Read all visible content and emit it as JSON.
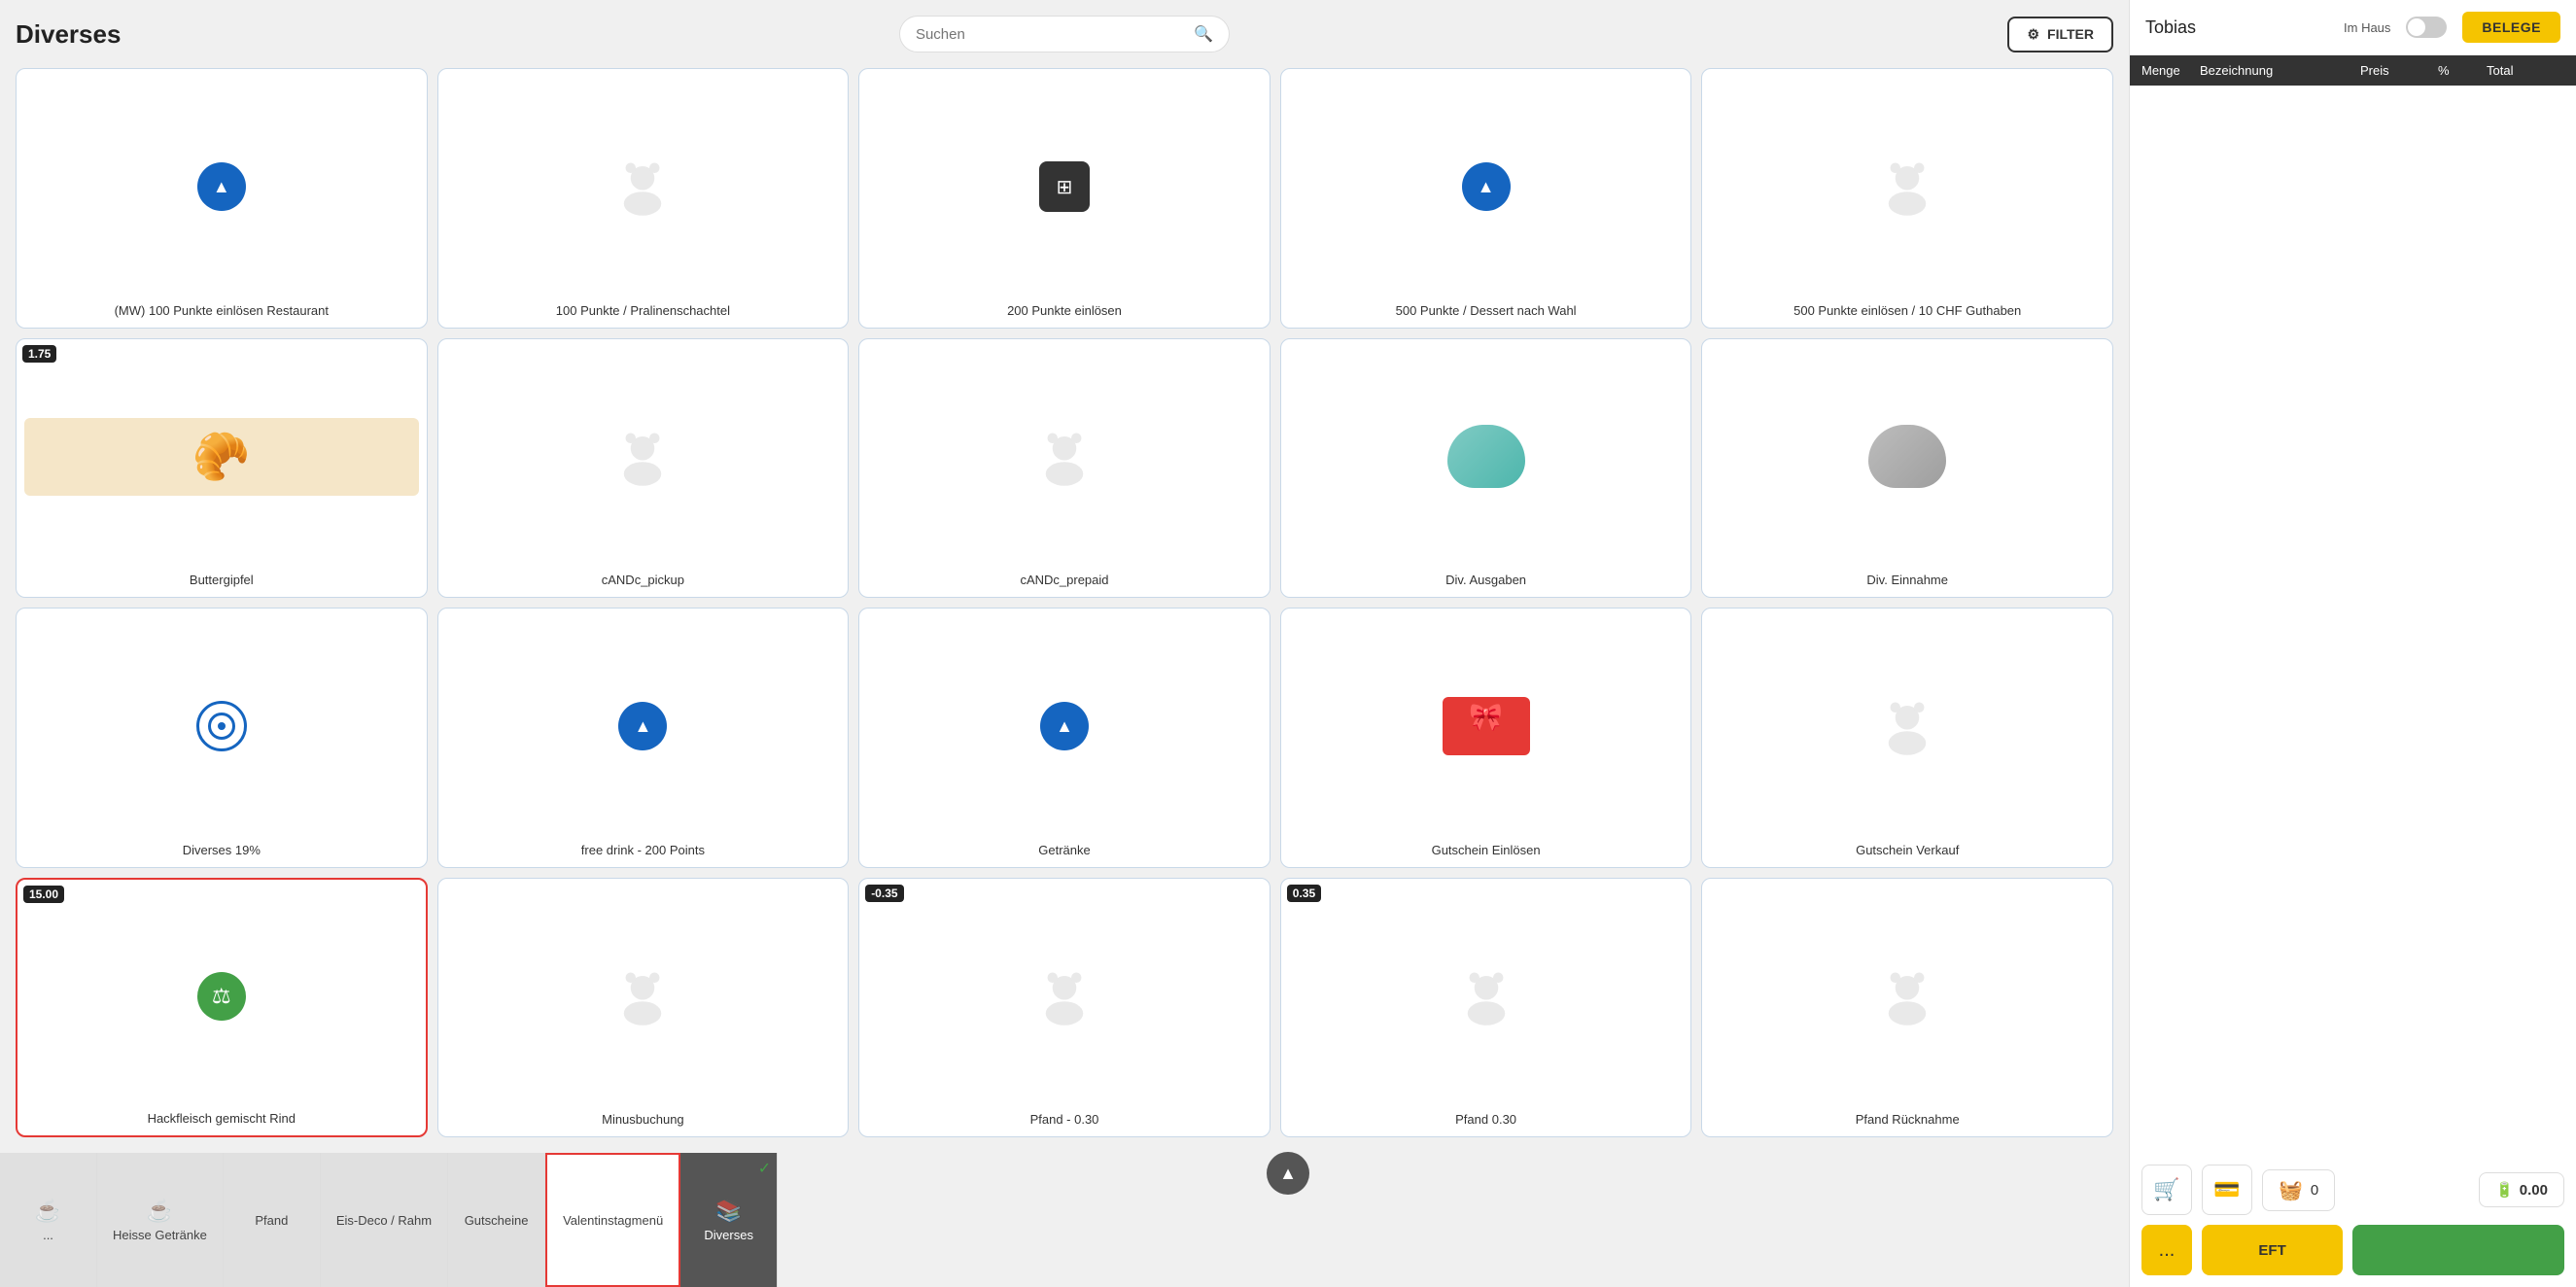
{
  "page": {
    "title": "Diverses"
  },
  "header": {
    "search_placeholder": "Suchen",
    "filter_label": "FILTER",
    "user_name": "Tobias",
    "im_haus_label": "Im Haus",
    "belege_label": "BELEGE"
  },
  "receipt_table": {
    "columns": [
      "Menge",
      "Bezeichnung",
      "Preis",
      "%",
      "Total"
    ]
  },
  "products": [
    {
      "id": "p1",
      "label": "(MW) 100 Punkte einlösen Restaurant",
      "icon_type": "blue_circle",
      "price": null,
      "selected": false
    },
    {
      "id": "p2",
      "label": "100 Punkte / Pralinenschachtel",
      "icon_type": "placeholder",
      "price": null,
      "selected": false
    },
    {
      "id": "p3",
      "label": "200 Punkte einlösen",
      "icon_type": "black_square",
      "price": null,
      "selected": false
    },
    {
      "id": "p4",
      "label": "500 Punkte / Dessert nach Wahl",
      "icon_type": "blue_circle",
      "price": null,
      "selected": false
    },
    {
      "id": "p5",
      "label": "500 Punkte einlösen / 10 CHF Guthaben",
      "icon_type": "placeholder",
      "price": null,
      "selected": false
    },
    {
      "id": "p6",
      "label": "Buttergipfel",
      "icon_type": "croissant",
      "price": "1.75",
      "selected": false
    },
    {
      "id": "p7",
      "label": "cANDc_pickup",
      "icon_type": "placeholder",
      "price": null,
      "selected": false
    },
    {
      "id": "p8",
      "label": "cANDc_prepaid",
      "icon_type": "placeholder",
      "price": null,
      "selected": false
    },
    {
      "id": "p9",
      "label": "Div. Ausgaben",
      "icon_type": "piggy_green",
      "price": null,
      "selected": false
    },
    {
      "id": "p10",
      "label": "Div. Einnahme",
      "icon_type": "piggy_grey",
      "price": null,
      "selected": false
    },
    {
      "id": "p11",
      "label": "Diverses 19%",
      "icon_type": "target",
      "price": null,
      "selected": false
    },
    {
      "id": "p12",
      "label": "free drink - 200 Points",
      "icon_type": "blue_circle",
      "price": null,
      "selected": false
    },
    {
      "id": "p13",
      "label": "Getränke",
      "icon_type": "blue_circle",
      "price": null,
      "selected": false
    },
    {
      "id": "p14",
      "label": "Gutschein Einlösen",
      "icon_type": "gift_card",
      "price": null,
      "selected": false
    },
    {
      "id": "p15",
      "label": "Gutschein Verkauf",
      "icon_type": "placeholder",
      "price": null,
      "selected": false
    },
    {
      "id": "p16",
      "label": "Hackfleisch gemischt Rind",
      "icon_type": "green_circle",
      "price": "15.00",
      "selected": true
    },
    {
      "id": "p17",
      "label": "Minusbuchung",
      "icon_type": "placeholder",
      "price": null,
      "selected": false
    },
    {
      "id": "p18",
      "label": "Pfand - 0.30",
      "icon_type": "placeholder",
      "price": "-0.35",
      "selected": false
    },
    {
      "id": "p19",
      "label": "Pfand 0.30",
      "icon_type": "placeholder",
      "price": "0.35",
      "selected": false
    },
    {
      "id": "p20",
      "label": "Pfand Rücknahme",
      "icon_type": "placeholder",
      "price": null,
      "selected": false
    }
  ],
  "categories": [
    {
      "id": "c1",
      "label": "...",
      "icon": "☕",
      "active": false
    },
    {
      "id": "c2",
      "label": "Heisse Getränke",
      "icon": "☕",
      "active": false
    },
    {
      "id": "c3",
      "label": "Pfand",
      "icon": "",
      "active": false
    },
    {
      "id": "c4",
      "label": "Eis-Deco / Rahm",
      "icon": "",
      "active": false
    },
    {
      "id": "c5",
      "label": "Gutscheine",
      "icon": "",
      "active": false
    },
    {
      "id": "c6",
      "label": "Valentinstagmenü",
      "icon": "",
      "active": false,
      "outlined": true
    },
    {
      "id": "c7",
      "label": "Diverses",
      "icon": "📚",
      "active": true,
      "checkmark": true
    }
  ],
  "footer": {
    "basket_count": "0",
    "total": "0.00",
    "dots_label": "...",
    "eft_label": "EFT",
    "pay_label": ""
  }
}
